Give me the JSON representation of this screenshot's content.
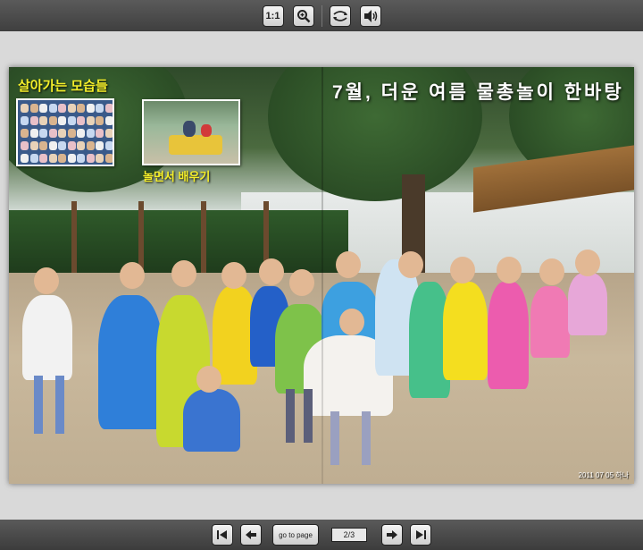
{
  "toolbar": {
    "actual_size_label": "1:1",
    "zoom_icon": "magnifier-icon",
    "flip_icon": "page-flip-icon",
    "sound_icon": "speaker-icon"
  },
  "book": {
    "left_title": "살아가는 모습들",
    "left_caption": "놀면서 배우기",
    "right_title": "7월, 더운 여름 물총놀이 한바탕",
    "datestamp": "2011 07 05 하나"
  },
  "navigation": {
    "first_icon": "first-page-icon",
    "prev_icon": "prev-page-icon",
    "goto_label": "go to page",
    "page_indicator": "2/3",
    "next_icon": "next-page-icon",
    "last_icon": "last-page-icon"
  },
  "colors": {
    "title_yellow": "#f4ee2a",
    "bar_dark": "#444444",
    "page_bg": "#d9d9d9"
  }
}
